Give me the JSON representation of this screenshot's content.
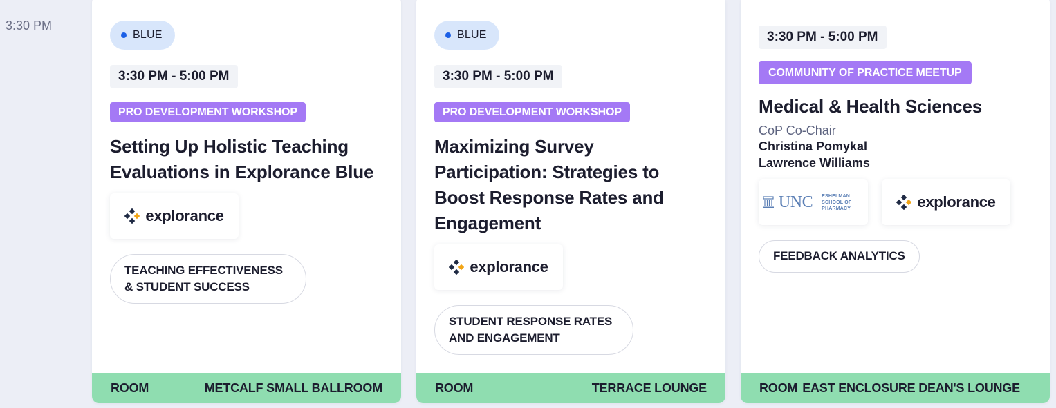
{
  "time_label": "3:30 PM",
  "sessions": [
    {
      "track": "BLUE",
      "time": "3:30 PM - 5:00 PM",
      "type": "PRO DEVELOPMENT WORKSHOP",
      "title": "Setting Up Holistic Teaching Evaluations in Explorance Blue",
      "sponsor": "explorance",
      "topic": "TEACHING EFFECTIVENESS & STUDENT SUCCESS",
      "room_label": "ROOM",
      "room": "METCALF SMALL BALLROOM"
    },
    {
      "track": "BLUE",
      "time": "3:30 PM - 5:00 PM",
      "type": "PRO DEVELOPMENT WORKSHOP",
      "title": "Maximizing Survey Participation: Strategies to Boost Response Rates and Engagement",
      "sponsor": "explorance",
      "topic": "STUDENT RESPONSE RATES AND ENGAGEMENT",
      "room_label": "ROOM",
      "room": "TERRACE LOUNGE"
    },
    {
      "time": "3:30 PM - 5:00 PM",
      "type": "COMMUNITY OF PRACTICE MEETUP",
      "title": "Medical & Health Sciences",
      "role": "CoP Co-Chair",
      "people": [
        "Christina Pomykal",
        "Lawrence Williams"
      ],
      "unc_logo": "UNC",
      "unc_logo_sub": "ESHELMAN SCHOOL OF PHARMACY",
      "sponsor": "explorance",
      "topic": "FEEDBACK ANALYTICS",
      "room_label": "ROOM",
      "room": "EAST ENCLOSURE DEAN'S LOUNGE"
    }
  ],
  "colors": {
    "track_pill": "#d8e6fb",
    "type_tag": "#a479f5",
    "room_bar": "#8fddb0"
  }
}
